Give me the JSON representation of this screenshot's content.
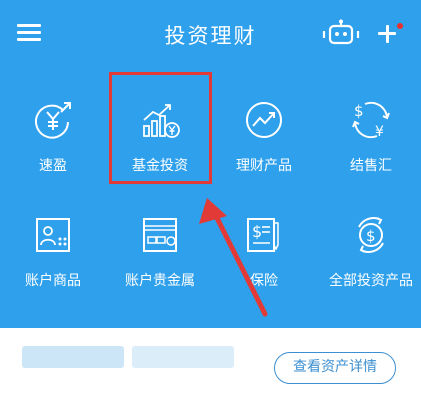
{
  "header": {
    "title": "投资理财",
    "menu_icon": "menu-icon",
    "robot_icon": "robot-icon",
    "add_icon": "plus-icon",
    "notification_dot_color": "#e8312f"
  },
  "grid": [
    {
      "label": "速盈",
      "icon": "yuan-arrows-icon"
    },
    {
      "label": "基金投资",
      "icon": "fund-chart-icon"
    },
    {
      "label": "理财产品",
      "icon": "trend-up-icon"
    },
    {
      "label": "结售汇",
      "icon": "currency-exchange-icon"
    },
    {
      "label": "账户商品",
      "icon": "account-goods-icon"
    },
    {
      "label": "账户贵金属",
      "icon": "precious-metal-icon"
    },
    {
      "label": "保险",
      "icon": "insurance-icon"
    },
    {
      "label": "全部投资产品",
      "icon": "all-products-icon"
    }
  ],
  "bottom": {
    "detail_button": "查看资产详情"
  },
  "colors": {
    "panel": "#2fa0ec",
    "highlight": "#e23a36",
    "button": "#3c8fd1"
  }
}
